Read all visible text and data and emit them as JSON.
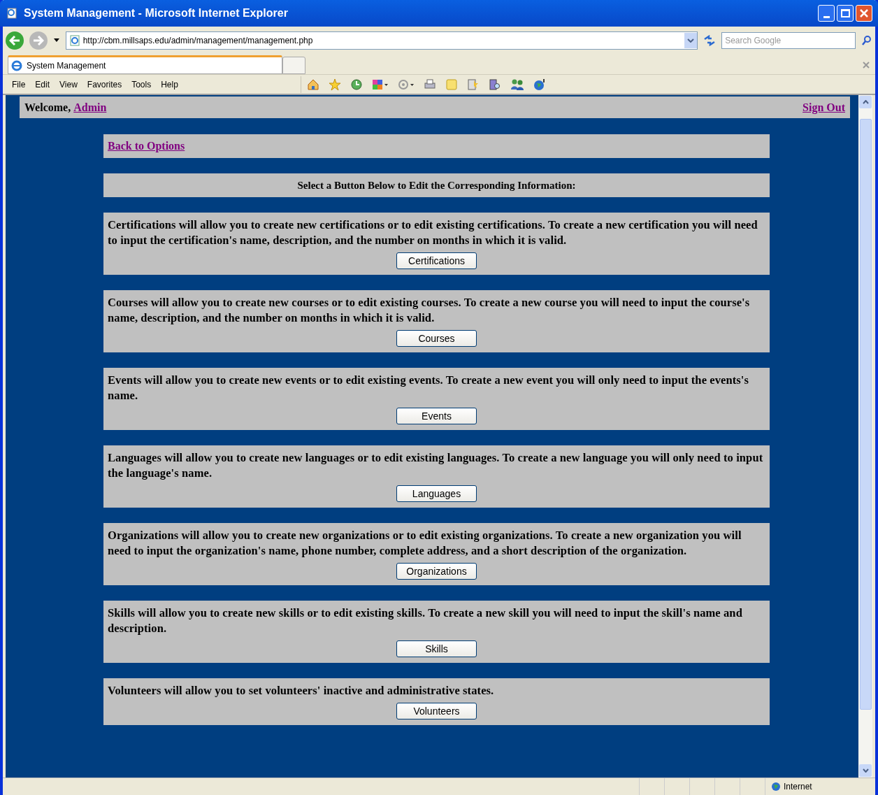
{
  "window": {
    "title": "System Management - Microsoft Internet Explorer"
  },
  "address_bar": {
    "url": "http://cbm.millsaps.edu/admin/management/management.php"
  },
  "search": {
    "placeholder": "Search Google"
  },
  "tabs": [
    {
      "label": "System Management",
      "selected": true
    }
  ],
  "menu": [
    "File",
    "Edit",
    "View",
    "Favorites",
    "Tools",
    "Help"
  ],
  "header": {
    "welcome": "Welcome,",
    "user": "Admin",
    "sign_out": "Sign Out"
  },
  "back_link": "Back to Options",
  "instruction": "Select a Button Below to Edit the Corresponding Information:",
  "sections": [
    {
      "description": "Certifications will allow you to create new certifications or to edit existing certifications. To create a new certification you will need to input the certification's name, description, and the number on months in which it is valid.",
      "button": "Certifications"
    },
    {
      "description": "Courses will allow you to create new courses or to edit existing courses. To create a new course you will need to input the course's name, description, and the number on months in which it is valid.",
      "button": "Courses"
    },
    {
      "description": "Events will allow you to create new events or to edit existing events. To create a new event you will only need to input the events's name.",
      "button": "Events"
    },
    {
      "description": "Languages will allow you to create new languages or to edit existing languages. To create a new language you will only need to input the language's name.",
      "button": "Languages"
    },
    {
      "description": "Organizations will allow you to create new organizations or to edit existing organizations. To create a new organization you will need to input the organization's name, phone number, complete address, and a short description of the organization.",
      "button": "Organizations"
    },
    {
      "description": "Skills will allow you to create new skills or to edit existing skills. To create a new skill you will need to input the skill's name and description.",
      "button": "Skills"
    },
    {
      "description": "Volunteers will allow you to set volunteers' inactive and administrative states.",
      "button": "Volunteers"
    }
  ],
  "status_bar": {
    "zone": "Internet"
  }
}
